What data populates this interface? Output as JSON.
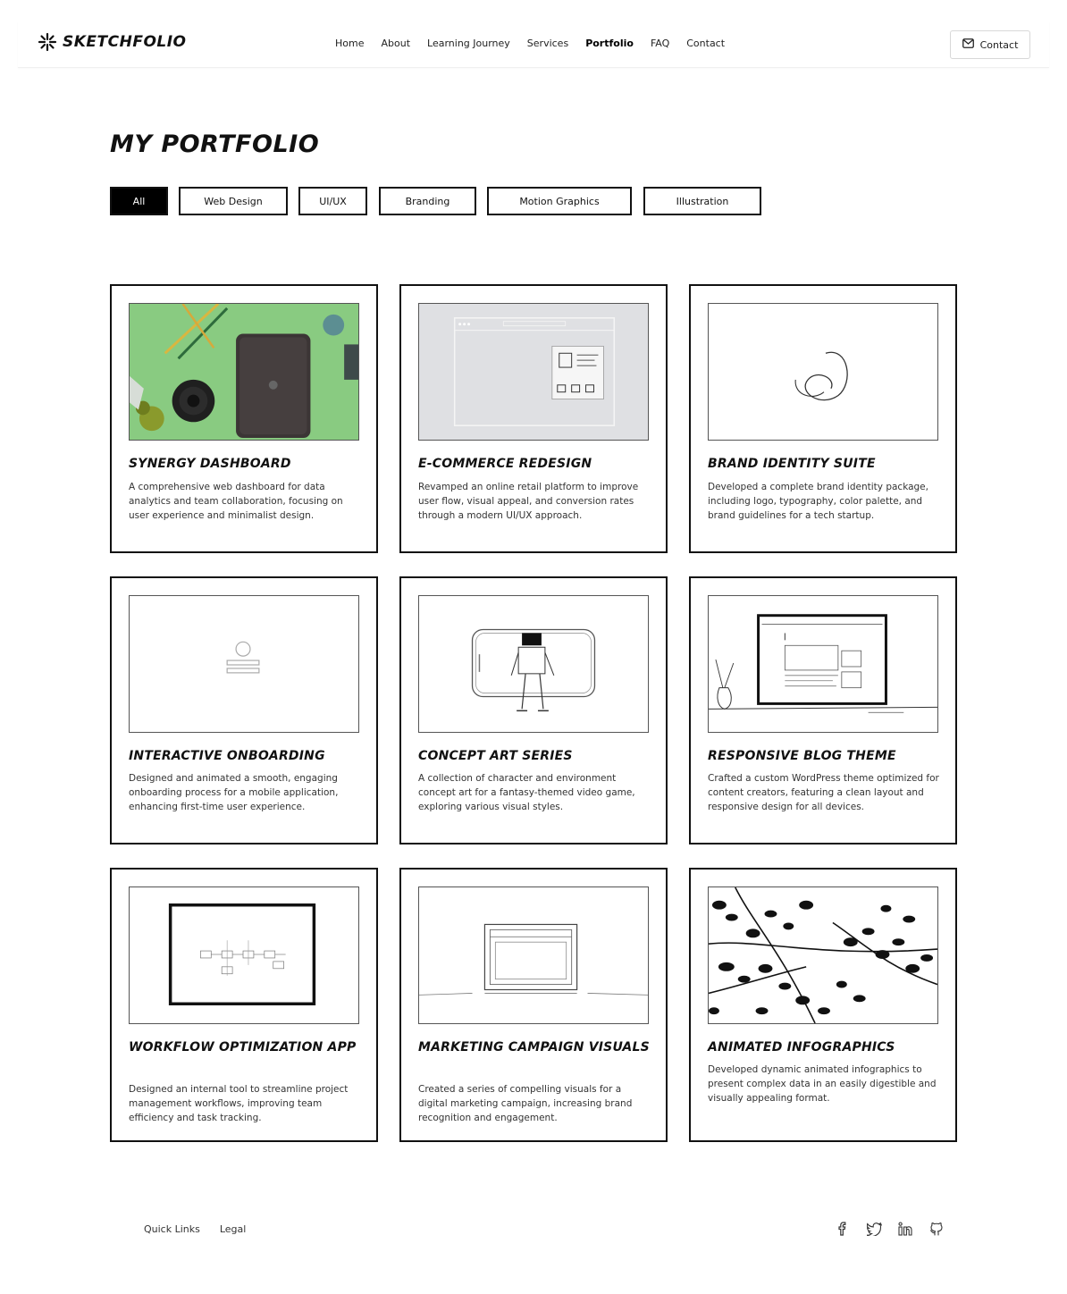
{
  "brand": {
    "name": "Sketchfolio"
  },
  "nav": {
    "items": [
      {
        "label": "Home",
        "active": false
      },
      {
        "label": "About",
        "active": false
      },
      {
        "label": "Learning Journey",
        "active": false
      },
      {
        "label": "Services",
        "active": false
      },
      {
        "label": "Portfolio",
        "active": true
      },
      {
        "label": "FAQ",
        "active": false
      },
      {
        "label": "Contact",
        "active": false
      }
    ],
    "contact_button": "Contact"
  },
  "page": {
    "title": "My Portfolio"
  },
  "filters": [
    {
      "label": "All",
      "active": true
    },
    {
      "label": "Web Design",
      "active": false
    },
    {
      "label": "UI/UX",
      "active": false
    },
    {
      "label": "Branding",
      "active": false
    },
    {
      "label": "Motion Graphics",
      "active": false
    },
    {
      "label": "Illustration",
      "active": false
    }
  ],
  "projects": [
    {
      "title": "Synergy Dashboard",
      "description": "A comprehensive web dashboard for data analytics and team collaboration, focusing on user experience and minimalist design.",
      "image": "tablet-on-green-desk"
    },
    {
      "title": "E-Commerce Redesign",
      "description": "Revamped an online retail platform to improve user flow, visual appeal, and conversion rates through a modern UI/UX approach.",
      "image": "ecommerce-wireframe"
    },
    {
      "title": "Brand Identity Suite",
      "description": "Developed a complete brand identity package, including logo, typography, color palette, and brand guidelines for a tech startup.",
      "image": "brand-logo-sketch"
    },
    {
      "title": "Interactive Onboarding",
      "description": "Designed and animated a smooth, engaging onboarding process for a mobile application, enhancing first-time user experience.",
      "image": "onboarding-placeholder"
    },
    {
      "title": "Concept Art Series",
      "description": "A collection of character and environment concept art for a fantasy-themed video game, exploring various visual styles.",
      "image": "robot-phone-sketch"
    },
    {
      "title": "Responsive Blog Theme",
      "description": "Crafted a custom WordPress theme optimized for content creators, featuring a clean layout and responsive design for all devices.",
      "image": "blog-monitor-sketch"
    },
    {
      "title": "Workflow Optimization App",
      "description": "Designed an internal tool to streamline project management workflows, improving team efficiency and task tracking.",
      "image": "workflow-diagram-frame"
    },
    {
      "title": "Marketing Campaign Visuals",
      "description": "Created a series of compelling visuals for a digital marketing campaign, increasing brand recognition and engagement.",
      "image": "marketing-screen-sketch"
    },
    {
      "title": "Animated Infographics",
      "description": "Developed dynamic animated infographics to present complex data in an easily digestible and visually appealing format.",
      "image": "leaf-silhouette"
    }
  ],
  "footer": {
    "links": [
      "Quick Links",
      "Legal"
    ],
    "socials": [
      "facebook-icon",
      "twitter-icon",
      "linkedin-icon",
      "github-icon"
    ]
  }
}
